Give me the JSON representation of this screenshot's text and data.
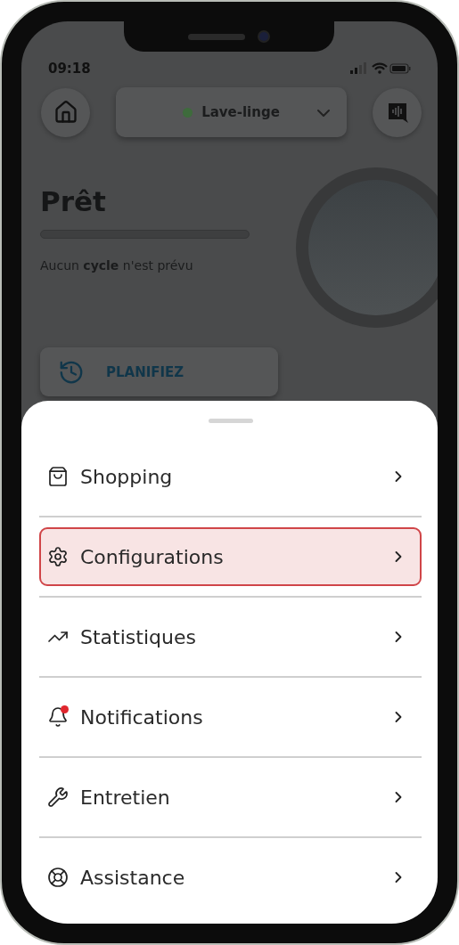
{
  "status_bar": {
    "time": "09:18"
  },
  "header": {
    "device": {
      "name": "Lave-linge",
      "connected": true
    }
  },
  "status": {
    "title": "Prêt",
    "message": "Aucun **cycle** n'est prévu"
  },
  "schedule_button": {
    "label": "PLANIFIEZ"
  },
  "menu": [
    {
      "kind": "shopping",
      "label": "Shopping",
      "selected": false,
      "badge": false
    },
    {
      "kind": "settings",
      "label": "Configurations",
      "selected": true,
      "badge": false
    },
    {
      "kind": "statistics",
      "label": "Statistiques",
      "selected": false,
      "badge": false
    },
    {
      "kind": "notifications",
      "label": "Notifications",
      "selected": false,
      "badge": true
    },
    {
      "kind": "maintenance",
      "label": "Entretien",
      "selected": false,
      "badge": false
    },
    {
      "kind": "support",
      "label": "Assistance",
      "selected": false,
      "badge": false
    }
  ]
}
